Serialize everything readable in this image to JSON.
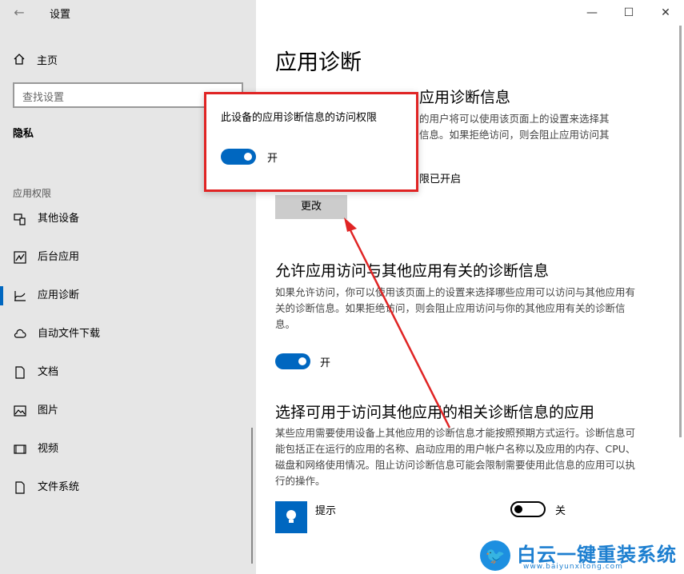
{
  "window": {
    "title": "设置",
    "controls": {
      "minimize": "—",
      "maximize": "☐",
      "close": "✕"
    }
  },
  "sidebar": {
    "home_label": "主页",
    "search_placeholder": "查找设置",
    "section_title": "隐私",
    "group_label": "应用权限",
    "items": [
      {
        "label": "其他设备",
        "icon": "devices-icon"
      },
      {
        "label": "后台应用",
        "icon": "background-apps-icon"
      },
      {
        "label": "应用诊断",
        "icon": "diagnostics-icon",
        "active": true
      },
      {
        "label": "自动文件下载",
        "icon": "cloud-icon"
      },
      {
        "label": "文档",
        "icon": "document-icon"
      },
      {
        "label": "图片",
        "icon": "picture-icon"
      },
      {
        "label": "视频",
        "icon": "video-icon"
      },
      {
        "label": "文件系统",
        "icon": "file-system-icon"
      }
    ]
  },
  "main": {
    "page_title": "应用诊断",
    "section1": {
      "heading_visible": "应用诊断信息",
      "desc_line1_visible": "的用户将可以使用该页面上的设置来选择其",
      "desc_line2_visible": "信息。如果拒绝访问，则会阻止应用访问其",
      "status_visible": "限已开启",
      "change_button": "更改"
    },
    "section2": {
      "heading": "允许应用访问与其他应用有关的诊断信息",
      "desc": "如果允许访问，你可以使用该页面上的设置来选择哪些应用可以访问与其他应用有关的诊断信息。如果拒绝访问，则会阻止应用访问与你的其他应用有关的诊断信息。",
      "toggle_label": "开"
    },
    "section3": {
      "heading": "选择可用于访问其他应用的相关诊断信息的应用",
      "desc": "某些应用需要使用设备上其他应用的诊断信息才能按照预期方式运行。诊断信息可能包括正在运行的应用的名称、启动应用的用户帐户名称以及应用的内存、CPU、磁盘和网络使用情况。阻止访问诊断信息可能会限制需要使用此信息的应用可以执行的操作。",
      "app_name": "提示",
      "app_toggle_label": "关"
    }
  },
  "popup": {
    "title": "此设备的应用诊断信息的访问权限",
    "toggle_label": "开"
  },
  "watermark": {
    "brand": "白云一键重装系统",
    "url": "www.baiyunxitong.com"
  },
  "colors": {
    "accent": "#0067c0",
    "highlight": "#e02424",
    "sidebar_bg": "#e6e6e6"
  }
}
